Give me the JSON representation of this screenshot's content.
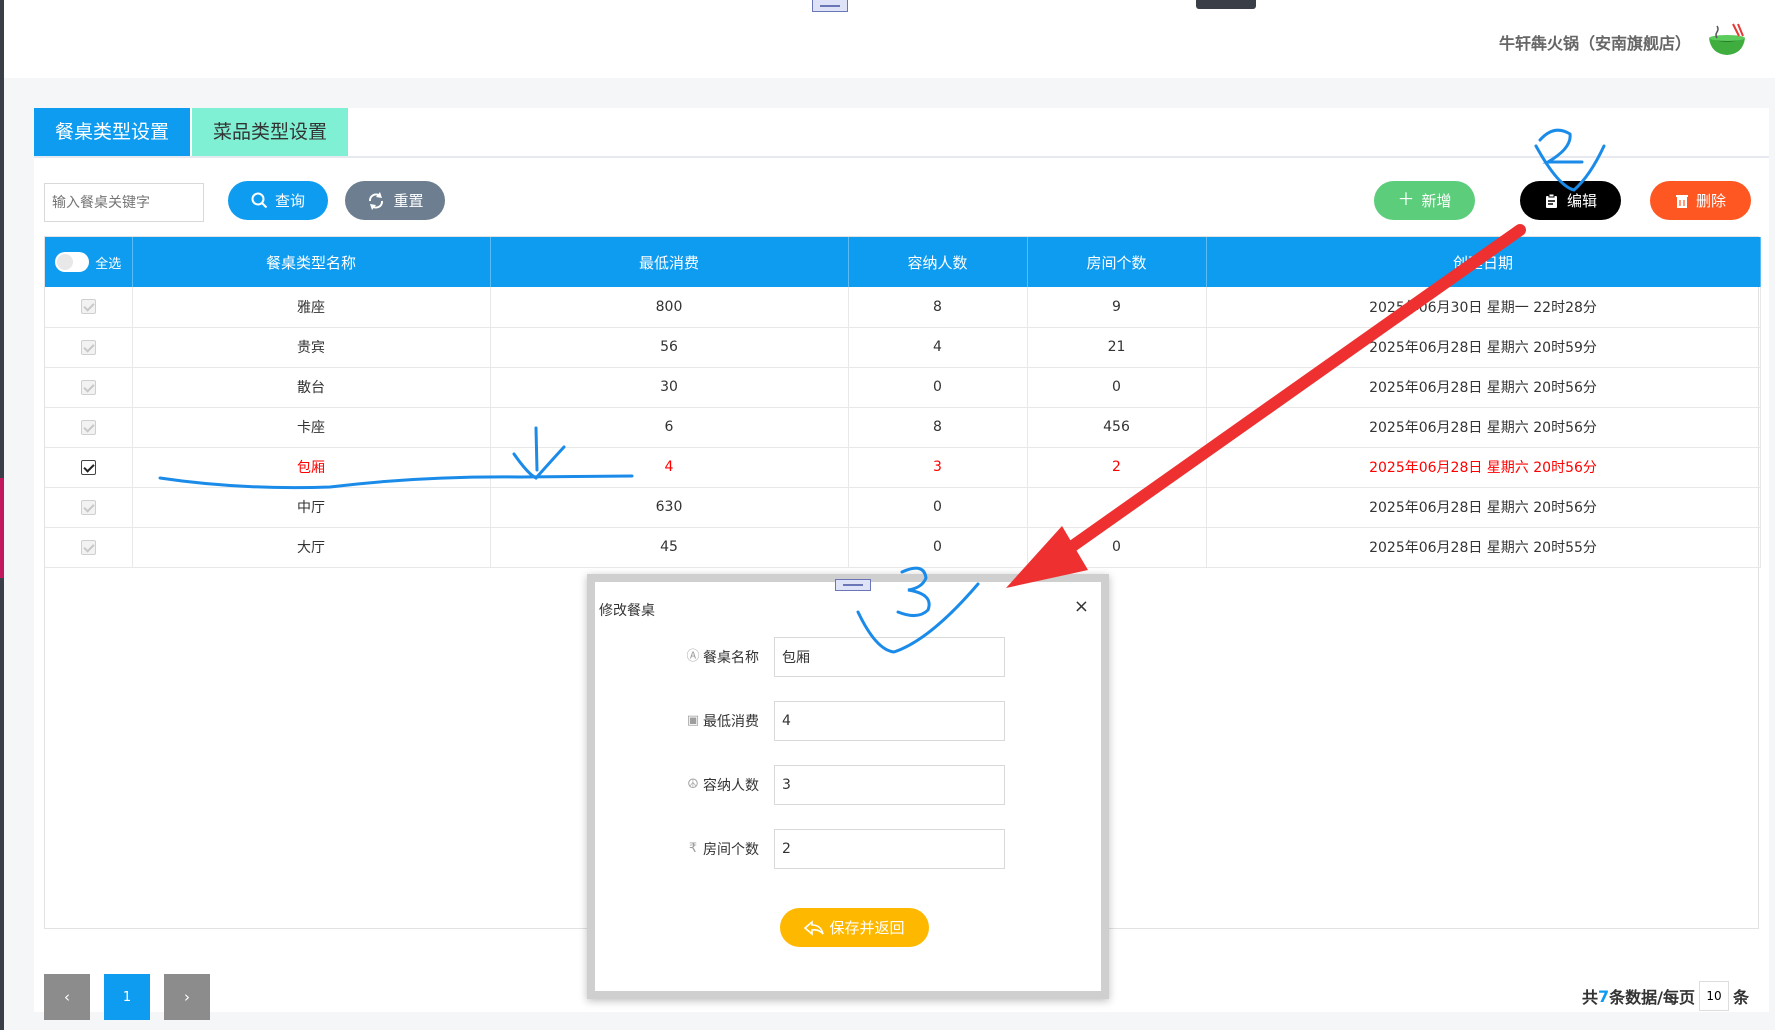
{
  "store": {
    "name": "牛轩犇火锅（安南旗舰店）"
  },
  "tabs": [
    {
      "label": "餐桌类型设置",
      "active": true
    },
    {
      "label": "菜品类型设置",
      "active": false
    }
  ],
  "search": {
    "placeholder": "输入餐桌关键字",
    "value": ""
  },
  "toolbar": {
    "query_label": "查询",
    "reset_label": "重置",
    "add_label": "新增",
    "edit_label": "编辑",
    "delete_label": "删除"
  },
  "table": {
    "select_all_label": "全选",
    "columns": [
      "餐桌类型名称",
      "最低消费",
      "容纳人数",
      "房间个数",
      "创建日期"
    ],
    "rows": [
      {
        "name": "雅座",
        "min_spend": "800",
        "capacity": "8",
        "rooms": "9",
        "date": "2025年06月30日  星期一  22时28分",
        "checked": false
      },
      {
        "name": "贵宾",
        "min_spend": "56",
        "capacity": "4",
        "rooms": "21",
        "date": "2025年06月28日  星期六  20时59分",
        "checked": false
      },
      {
        "name": "散台",
        "min_spend": "30",
        "capacity": "0",
        "rooms": "0",
        "date": "2025年06月28日  星期六  20时56分",
        "checked": false
      },
      {
        "name": "卡座",
        "min_spend": "6",
        "capacity": "8",
        "rooms": "456",
        "date": "2025年06月28日  星期六  20时56分",
        "checked": false
      },
      {
        "name": "包厢",
        "min_spend": "4",
        "capacity": "3",
        "rooms": "2",
        "date": "2025年06月28日  星期六  20时56分",
        "checked": true
      },
      {
        "name": "中厅",
        "min_spend": "630",
        "capacity": "0",
        "rooms": "",
        "date": "2025年06月28日  星期六  20时56分",
        "checked": false
      },
      {
        "name": "大厅",
        "min_spend": "45",
        "capacity": "0",
        "rooms": "0",
        "date": "2025年06月28日  星期六  20时55分",
        "checked": false
      }
    ]
  },
  "pager": {
    "prev": "‹",
    "current": "1",
    "next": "›",
    "total_prefix": "共",
    "total": "7",
    "total_suffix": "条数据/每页",
    "per_page": "10",
    "per_page_suffix": "条"
  },
  "modal": {
    "title": "修改餐桌",
    "close": "×",
    "fields": [
      {
        "label": "餐桌名称",
        "value": "包厢",
        "icon": "info-circle-icon"
      },
      {
        "label": "最低消费",
        "value": "4",
        "icon": "money-icon"
      },
      {
        "label": "容纳人数",
        "value": "3",
        "icon": "peace-icon"
      },
      {
        "label": "房间个数",
        "value": "2",
        "icon": "rupee-icon"
      }
    ],
    "save_label": "保存并返回"
  },
  "annotations": {
    "labels": [
      "1",
      "2",
      "3"
    ],
    "arrow_color": "#ee3030",
    "pen_color": "#1a8be8"
  },
  "colors": {
    "primary": "#0e9cf0",
    "tab_inactive": "#7ff0d3",
    "add": "#5ccd7a",
    "edit": "#000000",
    "delete": "#ff5722",
    "reset": "#6c7e8f",
    "save": "#ffb800",
    "selected_row_text": "#ff0000"
  }
}
